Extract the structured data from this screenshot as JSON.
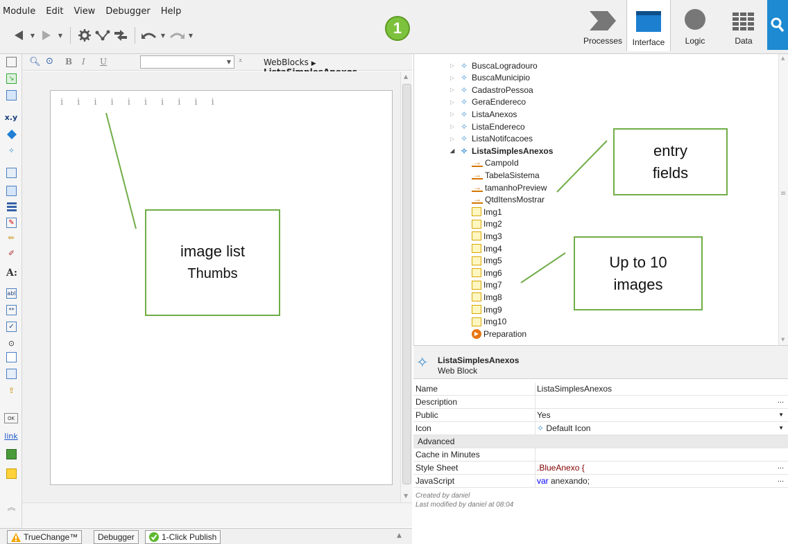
{
  "menu": [
    "Module",
    "Edit",
    "View",
    "Debugger",
    "Help"
  ],
  "badge": "1",
  "tabs": {
    "processes": "Processes",
    "interface": "Interface",
    "logic": "Logic",
    "data": "Data"
  },
  "editor": {
    "format_bold": "B",
    "format_italic": "I",
    "format_underline": "U",
    "breadcrumb_parent": "WebBlocks",
    "breadcrumb_current": "ListaSimplesAnexos",
    "toggle": "<>",
    "thumb_glyph": "i",
    "thumbs": [
      "i",
      "i",
      "i",
      "i",
      "i",
      "i",
      "i",
      "i",
      "i",
      "i"
    ]
  },
  "bottom_tabs": {
    "truechange": "TrueChange™",
    "debugger": "Debugger",
    "publish": "1-Click Publish"
  },
  "tree": {
    "items": [
      {
        "label": "BuscaLogradouro",
        "kind": "webblock"
      },
      {
        "label": "BuscaMunicipio",
        "kind": "webblock"
      },
      {
        "label": "CadastroPessoa",
        "kind": "webblock"
      },
      {
        "label": "GeraEndereco",
        "kind": "webblock"
      },
      {
        "label": "ListaAnexos",
        "kind": "webblock"
      },
      {
        "label": "ListaEndereco",
        "kind": "webblock"
      },
      {
        "label": "ListaNotifcacoes",
        "kind": "webblock"
      },
      {
        "label": "ListaSimplesAnexos",
        "kind": "webblock-open"
      },
      {
        "label": "CampoId",
        "kind": "input"
      },
      {
        "label": "TabelaSistema",
        "kind": "input"
      },
      {
        "label": "tamanhoPreview",
        "kind": "input"
      },
      {
        "label": "QtdItensMostrar",
        "kind": "input"
      },
      {
        "label": "Img1",
        "kind": "var"
      },
      {
        "label": "Img2",
        "kind": "var"
      },
      {
        "label": "Img3",
        "kind": "var"
      },
      {
        "label": "Img4",
        "kind": "var"
      },
      {
        "label": "Img5",
        "kind": "var"
      },
      {
        "label": "Img6",
        "kind": "var"
      },
      {
        "label": "Img7",
        "kind": "var"
      },
      {
        "label": "Img8",
        "kind": "var"
      },
      {
        "label": "Img9",
        "kind": "var"
      },
      {
        "label": "Img10",
        "kind": "var"
      },
      {
        "label": "Preparation",
        "kind": "prep"
      }
    ]
  },
  "properties": {
    "title": "ListaSimplesAnexos",
    "type": "Web Block",
    "name_label": "Name",
    "name_value": "ListaSimplesAnexos",
    "description_label": "Description",
    "description_value": "",
    "public_label": "Public",
    "public_value": "Yes",
    "icon_label": "Icon",
    "icon_value": "Default Icon",
    "advanced_label": "Advanced",
    "cache_label": "Cache in Minutes",
    "cache_value": "",
    "stylesheet_label": "Style Sheet",
    "stylesheet_value": ".BlueAnexo {",
    "javascript_label": "JavaScript",
    "javascript_keyword": "var",
    "javascript_rest": " anexando;",
    "ellipsis": "...",
    "created_by": "Created by daniel",
    "modified_by": "Last modified by daniel at 08:04"
  },
  "callouts": {
    "thumbs_line1": "image list",
    "thumbs_line2": "Thumbs",
    "entry_line1": "entry",
    "entry_line2": "fields",
    "images_line1": "Up to 10",
    "images_line2": "images"
  },
  "colors": {
    "accent_blue": "#1d8ad2",
    "badge_green": "#7dc23c",
    "callout_border": "#70ad47"
  }
}
